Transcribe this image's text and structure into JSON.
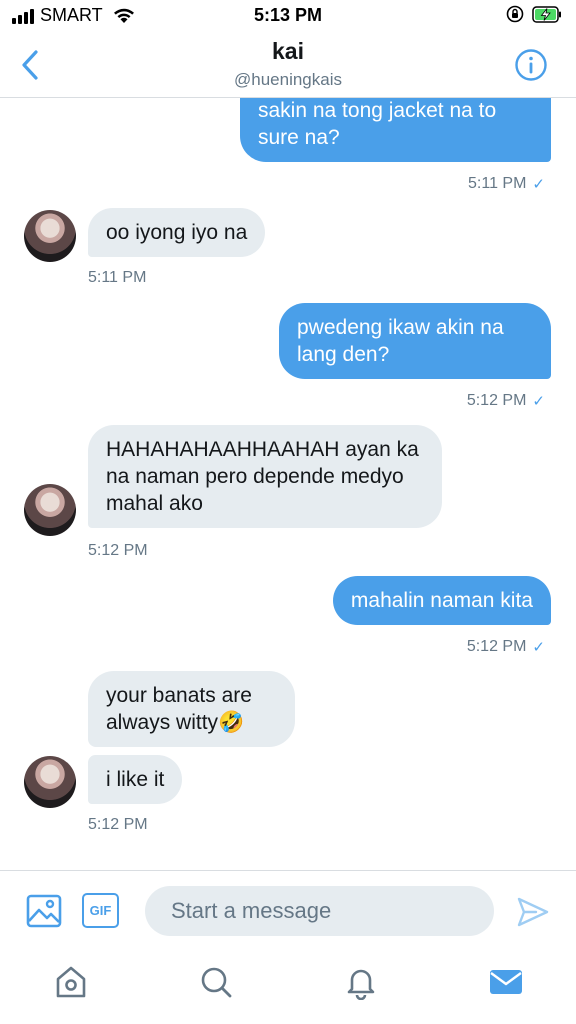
{
  "status_bar": {
    "carrier": "SMART",
    "time": "5:13 PM"
  },
  "header": {
    "title": "kai",
    "handle": "@hueningkais"
  },
  "messages": [
    {
      "from": "me",
      "lines": "sakin na tong jacket na to sure na?",
      "time": "5:11 PM"
    },
    {
      "from": "them",
      "lines": "oo iyong iyo na",
      "time": "5:11 PM"
    },
    {
      "from": "me",
      "lines": "pwedeng ikaw akin na lang den?",
      "time": "5:12 PM"
    },
    {
      "from": "them",
      "lines": "HAHAHAHAAHHAAHAH ayan ka na naman pero depende medyo mahal ako",
      "time": "5:12 PM"
    },
    {
      "from": "me",
      "lines": "mahalin naman kita",
      "time": "5:12 PM"
    },
    {
      "from": "them",
      "lines": "your banats are always witty🤣",
      "time": ""
    },
    {
      "from": "them",
      "lines": "i like it",
      "time": "5:12 PM"
    }
  ],
  "composer": {
    "gif_label": "GIF",
    "placeholder": "Start a message"
  },
  "colors": {
    "accent": "#4a9fe9",
    "bubble_received": "#e6ecf0",
    "muted_text": "#657786"
  },
  "icons": {
    "header": [
      "back-chevron-icon",
      "info-icon"
    ],
    "composer": [
      "image-icon",
      "gif-icon",
      "send-icon"
    ],
    "tabs": [
      "home-icon",
      "search-icon",
      "bell-icon",
      "mail-icon"
    ]
  }
}
